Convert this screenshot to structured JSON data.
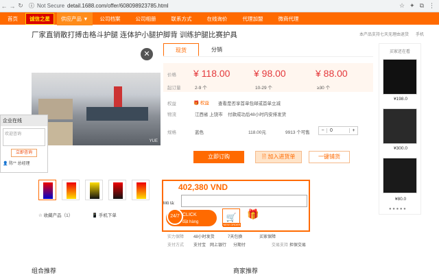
{
  "browser": {
    "security": "Not Secure",
    "url": "detail.1688.com/offer/608098923785.html"
  },
  "topnav": {
    "items": [
      "首页",
      "诚信之星",
      "供应产品 ▼",
      "公司档案",
      "公司相册",
      "联系方式",
      "在线询价",
      "代理加盟",
      "微商代理"
    ]
  },
  "product": {
    "title": "厂家直销散打搏击格斗护腿 连体护小腿护脚背 训练护腿比赛护具",
    "tip": "本产品支持七天无理由退货",
    "tip2": "手机",
    "watermark": "YUE"
  },
  "tabs": [
    "现货",
    "分销"
  ],
  "prices": {
    "label_price": "价格",
    "label_qty": "起订量",
    "items": [
      {
        "price": "¥ 118.00",
        "qty": "2-9 个"
      },
      {
        "price": "¥ 98.00",
        "qty": "10-29 个"
      },
      {
        "price": "¥ 88.00",
        "qty": "≥30 个"
      }
    ]
  },
  "rights": {
    "label": "权益",
    "value": "查看是否享首单包邮或首单立减",
    "tag": "权益"
  },
  "logistics": {
    "label": "物流",
    "from": "江西省 上饶市",
    "value": "付款成功后48小时内安排发货"
  },
  "spec": {
    "label": "规格",
    "color": "蓝色",
    "price": "118.00元",
    "stock": "9913 个可售",
    "qty": "0"
  },
  "buttons": {
    "order": "立即订购",
    "cart": "加入进货单",
    "oneclick": "一键铺货"
  },
  "side": {
    "header": "买家还在看",
    "prices": [
      "¥198.0",
      "¥300.0",
      "¥80.0"
    ]
  },
  "chat": {
    "header": "企业在线",
    "placeholder": "欢迎咨询",
    "send": "立即咨询",
    "footer": "陈** 总经理"
  },
  "favorites": {
    "label": "收藏产品（1）",
    "phone": "手机下单"
  },
  "vnd": {
    "amount": "402,380 VND",
    "note": "Mô tả:",
    "click_title": "CLICK",
    "click_sub": "đặt hàng",
    "circle": "24/7",
    "cart_label": "NEW ORDER"
  },
  "guarantee": {
    "label1": "实力保障",
    "v1": "48小时发货",
    "v2": "7天包换",
    "v3": "买家保障",
    "label2": "支付方式",
    "p1": "支付宝",
    "p2": "网上银行",
    "p3": "分期付",
    "label3": "交易支持",
    "p4": "担保交易"
  },
  "sections": {
    "left": "组合推荐",
    "right": "商家推荐"
  }
}
